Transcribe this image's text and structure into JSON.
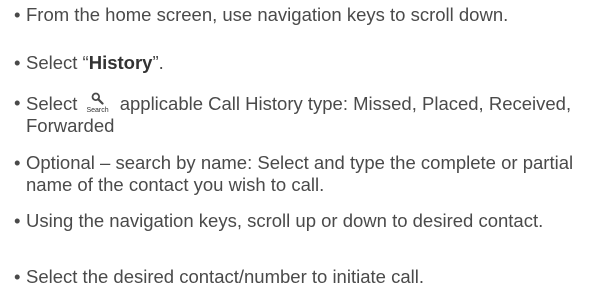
{
  "steps": [
    {
      "text": "From the home screen, use navigation keys to scroll down."
    },
    {
      "prefix": "Select “",
      "bold": "History",
      "suffix": "”."
    },
    {
      "prefix": "Select",
      "icon": {
        "name": "search-icon",
        "label": "Search"
      },
      "suffix": "applicable Call History type: Missed, Placed, Received, Forwarded"
    },
    {
      "text": "Optional – search by name: Select and type the complete or partial name of the contact you wish to call."
    },
    {
      "text": "Using the navigation keys, scroll up or down to desired contact."
    },
    {
      "text": "Select the desired contact/number to initiate call."
    }
  ]
}
